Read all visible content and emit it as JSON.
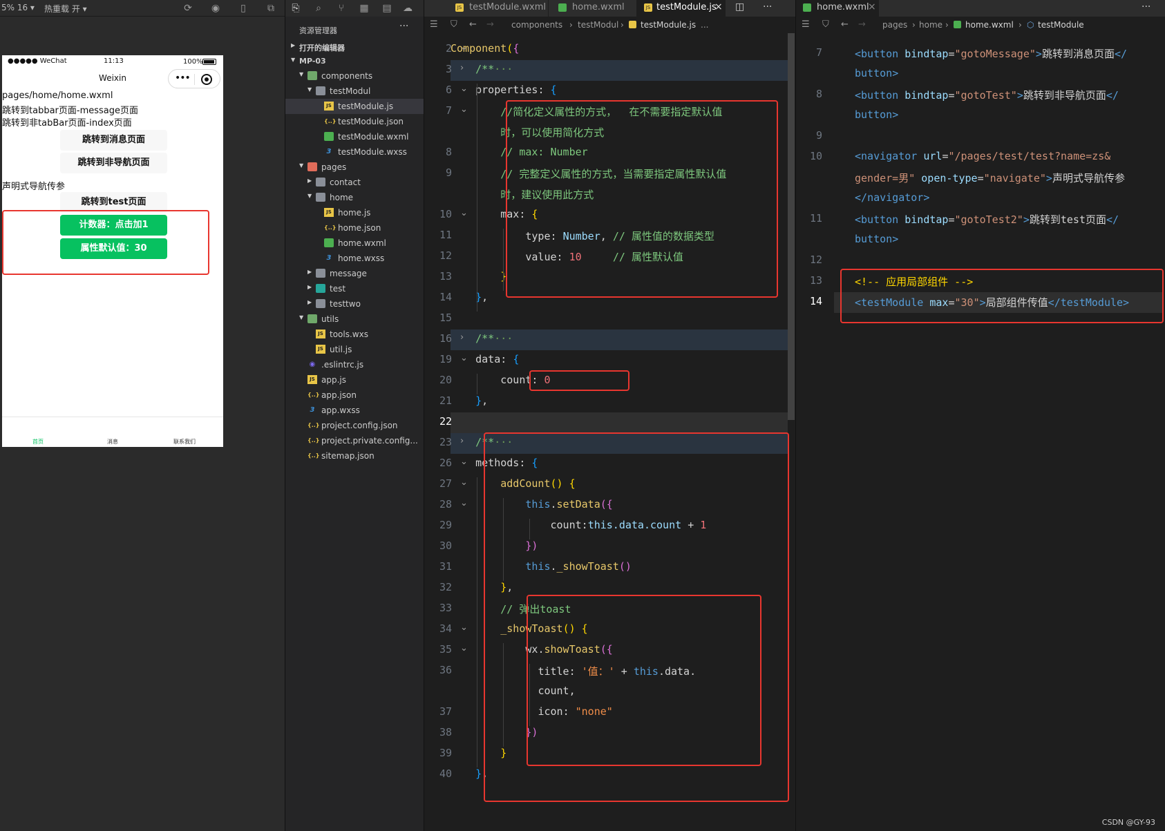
{
  "simulator": {
    "zoom_label": "5% 16 ▾",
    "hot_reload_label": "热重载 开 ▾",
    "status": {
      "carrier": "●●●●● WeChat",
      "time": "11:13",
      "battery": "100%"
    },
    "nav_title": "Weixin",
    "page_path": "pages/home/home.wxml",
    "text_tabbar_jump": "跳转到tabbar页面-message页面",
    "text_non_tabbar_jump": "跳转到非tabBar页面-index页面",
    "btn_message": "跳转到消息页面",
    "btn_nonnav": "跳转到非导航页面",
    "text_navigator": "声明式导航传参",
    "btn_test": "跳转到test页面",
    "btn_counter": "计数器：点击加1",
    "btn_default": "属性默认值：30",
    "tabs": [
      "首页",
      "消息",
      "联系我们"
    ]
  },
  "explorer": {
    "title": "资源管理器",
    "more": "···",
    "open_editors": "打开的编辑器",
    "project": "MP-03",
    "items": [
      {
        "label": "components",
        "type": "folder"
      },
      {
        "label": "testModul",
        "type": "folder"
      },
      {
        "label": "testModule.js",
        "type": "js"
      },
      {
        "label": "testModule.json",
        "type": "json"
      },
      {
        "label": "testModule.wxml",
        "type": "wxml"
      },
      {
        "label": "testModule.wxss",
        "type": "wxss"
      },
      {
        "label": "pages",
        "type": "folder"
      },
      {
        "label": "contact",
        "type": "folder"
      },
      {
        "label": "home",
        "type": "folder"
      },
      {
        "label": "home.js",
        "type": "js"
      },
      {
        "label": "home.json",
        "type": "json"
      },
      {
        "label": "home.wxml",
        "type": "wxml"
      },
      {
        "label": "home.wxss",
        "type": "wxss"
      },
      {
        "label": "message",
        "type": "folder"
      },
      {
        "label": "test",
        "type": "folder"
      },
      {
        "label": "testtwo",
        "type": "folder"
      },
      {
        "label": "utils",
        "type": "folder"
      },
      {
        "label": "tools.wxs",
        "type": "js"
      },
      {
        "label": "util.js",
        "type": "js"
      },
      {
        "label": ".eslintrc.js",
        "type": "eslint"
      },
      {
        "label": "app.js",
        "type": "js"
      },
      {
        "label": "app.json",
        "type": "json"
      },
      {
        "label": "app.wxss",
        "type": "wxss"
      },
      {
        "label": "project.config.json",
        "type": "json"
      },
      {
        "label": "project.private.config...",
        "type": "json"
      },
      {
        "label": "sitemap.json",
        "type": "json"
      }
    ]
  },
  "editor1": {
    "tabs": [
      "testModule.wxml",
      "home.wxml",
      "testModule.js"
    ],
    "crumb": [
      "components",
      "testModul",
      "testModule.js",
      "..."
    ],
    "line_numbers": [
      "2",
      "3",
      "6",
      "7",
      "",
      "8",
      "9",
      "",
      "10",
      "11",
      "12",
      "13",
      "14",
      "15",
      "16",
      "19",
      "20",
      "21",
      "22",
      "23",
      "26",
      "27",
      "28",
      "29",
      "30",
      "31",
      "32",
      "33",
      "34",
      "35",
      "36",
      "",
      "37",
      "38",
      "39",
      "40"
    ],
    "code": {
      "component": "Component",
      "doc": "/**",
      "ellipsis": "···",
      "properties": "properties",
      "c1a": "//简化定义属性的方式，  在不需要指定默认值",
      "c1b": "时，可以使用简化方式",
      "c2": "// max: Number",
      "c3a": "// 完整定义属性的方式，当需要指定属性默认值",
      "c3b": "时，建议使用此方式",
      "max": "max",
      "type": "type",
      "number_type": "Number",
      "c4": "// 属性值的数据类型",
      "value": "value",
      "val10": "10",
      "c5": "// 属性默认值",
      "data": "data",
      "count": "count",
      "val0": "0",
      "methods": "methods",
      "addCount": "addCount",
      "this": "this",
      "setData": "setData",
      "count2": "count",
      "this_data_count": "this.data.count",
      "plus": "+",
      "val1": "1",
      "showToastCall": "_showToast",
      "c6": "// 弹出toast",
      "wx": "wx",
      "showToast": "showToast",
      "title": "title",
      "str_val": "'值：'",
      "this2": "this",
      "data2": "data.",
      "count3": "count,",
      "icon": "icon",
      "none": "\"none\""
    }
  },
  "editor2": {
    "tabs": [
      "home.wxml"
    ],
    "crumb": [
      "pages",
      "home",
      "home.wxml",
      "testModule"
    ],
    "line_numbers": [
      "7",
      "",
      "8",
      "",
      "9",
      "10",
      "",
      "",
      "11",
      "",
      "12",
      "13",
      "14"
    ],
    "code": {
      "button": "button",
      "bindtap": "bindtap",
      "gotoMessage": "\"gotoMessage\"",
      "txt_message": "跳转到消息页面",
      "gotoTest": "\"gotoTest\"",
      "txt_nonnav": "跳转到非导航页面",
      "navigator": "navigator",
      "url": "url",
      "url_val_a": "\"/pages/test/test?name=zs&",
      "url_val_b": "gender=男\"",
      "open_type": "open-type",
      "navigate": "\"navigate\"",
      "txt_nav": "声明式导航传参",
      "gotoTest2": "\"gotoTest2\"",
      "txt_test": "跳转到test页面",
      "comment": "<!-- 应用局部组件 -->",
      "testModule": "testModule",
      "maxattr": "max",
      "max_val": "\"30\"",
      "txt_local": "局部组件传值"
    }
  },
  "watermark": "CSDN @GY-93",
  "colors": {
    "accent_green": "#07c160",
    "highlight_red": "#e8362f"
  }
}
